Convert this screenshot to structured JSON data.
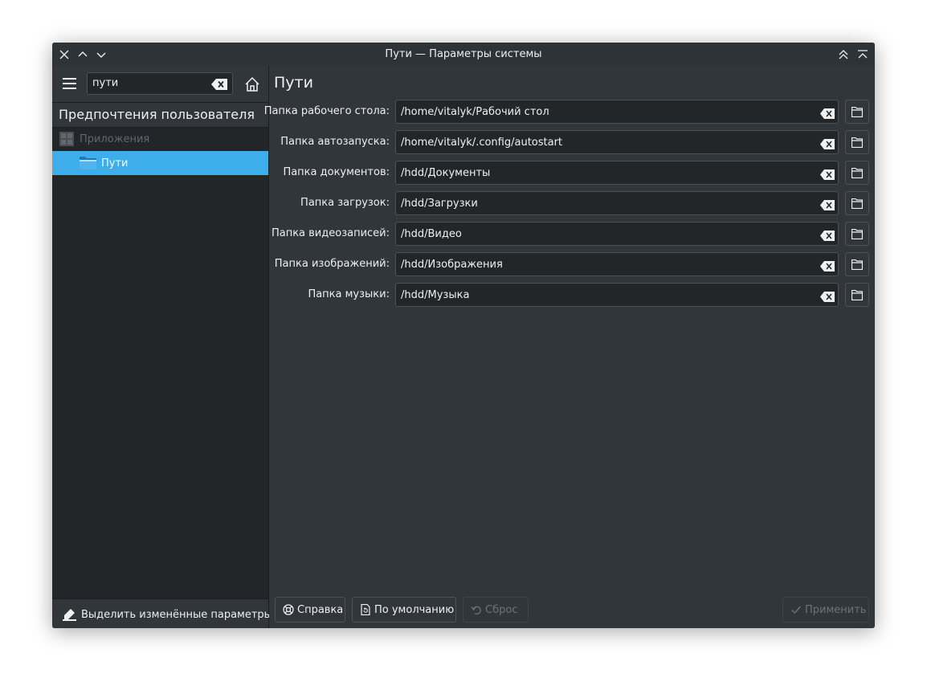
{
  "window": {
    "title": "Пути — Параметры системы"
  },
  "sidebar": {
    "search": {
      "value": "пути",
      "placeholder": ""
    },
    "section_title": "Предпочтения пользователя",
    "tree": [
      {
        "label": "Приложения",
        "enabled": false
      },
      {
        "label": "Пути",
        "selected": true
      }
    ],
    "highlight_changed_label": "Выделить изменённые параметры"
  },
  "main": {
    "title": "Пути",
    "fields": [
      {
        "label": "Папка рабочего стола:",
        "value": "/home/vitalyk/Рабочий стол"
      },
      {
        "label": "Папка автозапуска:",
        "value": "/home/vitalyk/.config/autostart"
      },
      {
        "label": "Папка документов:",
        "value": "/hdd/Документы"
      },
      {
        "label": "Папка загрузок:",
        "value": "/hdd/Загрузки"
      },
      {
        "label": "Папка видеозаписей:",
        "value": "/hdd/Видео"
      },
      {
        "label": "Папка изображений:",
        "value": "/hdd/Изображения"
      },
      {
        "label": "Папка музыки:",
        "value": "/hdd/Музыка"
      }
    ]
  },
  "buttons": {
    "help": "Справка",
    "defaults": "По умолчанию",
    "reset": "Сброс",
    "apply": "Применить"
  },
  "colors": {
    "window_bg": "#31363b",
    "sidebar_bg": "#232629",
    "selection": "#3daee9",
    "text": "#eff0f1",
    "disabled_text": "#6e7378"
  },
  "icons": {
    "close": "close-icon",
    "minimize": "chevron-up-icon",
    "maximize": "chevron-down-icon",
    "keep_above": "keep-above-icon",
    "shade": "shade-icon",
    "menu": "hamburger-menu-icon",
    "clear": "clear-text-icon",
    "home": "home-icon",
    "applications": "applications-icon",
    "folder": "folder-icon",
    "highlight": "highlighter-icon",
    "help": "help-lifebuoy-icon",
    "defaults": "document-revert-icon",
    "reset": "undo-icon",
    "apply": "checkmark-icon"
  }
}
